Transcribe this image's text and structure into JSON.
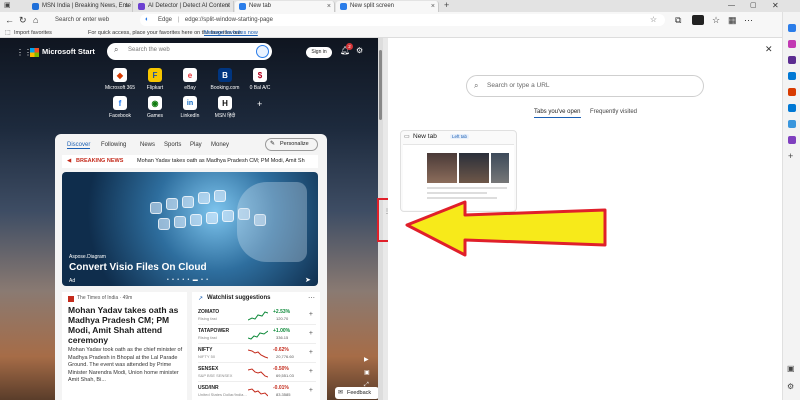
{
  "tabs": [
    {
      "title": "MSN India | Breaking News, Ente",
      "color": "#1e6fd9"
    },
    {
      "title": "AI Detector | Detect AI Content",
      "color": "#6b3fd1"
    },
    {
      "title": "New tab",
      "color": "#2b7de9"
    },
    {
      "title": "New split screen",
      "color": "#2b7de9"
    }
  ],
  "toolbar": {
    "left_address_placeholder": "Search or enter web address",
    "browser_name": "Edge",
    "url": "edge://split-window-starting-page"
  },
  "favorites": {
    "import_label": "Import favorites",
    "hint": "For quick access, place your favorites here on the favorites bar.",
    "manage_link": "Manage favorites now"
  },
  "msn": {
    "brand": "Microsoft Start",
    "search_placeholder": "Search the web",
    "signin": "Sign in",
    "notif_count": "2",
    "shortcuts": [
      {
        "label": "Microsoft 365",
        "glyph": "◆",
        "color": "#d83b01"
      },
      {
        "label": "Flipkart",
        "glyph": "F",
        "color": "#f7c600"
      },
      {
        "label": "eBay",
        "glyph": "e",
        "color": "#e53238"
      },
      {
        "label": "Booking.com",
        "glyph": "B",
        "color": "#003580"
      },
      {
        "label": "0 Bal A/C",
        "glyph": "$",
        "color": "#b2001f"
      },
      {
        "label": "Facebook",
        "glyph": "f",
        "color": "#1877f2"
      },
      {
        "label": "Games",
        "glyph": "◉",
        "color": "#107c10"
      },
      {
        "label": "LinkedIn",
        "glyph": "in",
        "color": "#0a66c2"
      },
      {
        "label": "MSN हिंदी",
        "glyph": "H",
        "color": "#111111"
      }
    ],
    "feed_tabs": [
      "Discover",
      "Following",
      "News",
      "Sports",
      "Play",
      "Money"
    ],
    "personalize": "Personalize",
    "breaking_label": "BREAKING NEWS",
    "breaking_text": "Mohan Yadav takes oath as Madhya Pradesh CM; PM Modi, Amit Sh",
    "hero": {
      "source": "Aspose.Diagram",
      "title": "Convert Visio Files On Cloud",
      "ad": "Ad"
    },
    "news": {
      "source": "The Times of India · 49m",
      "title": "Mohan Yadav takes oath as Madhya Pradesh CM; PM Modi, Amit Shah attend ceremony",
      "body": "Mohan Yadav took oath as the chief minister of Madhya Pradesh in Bhopal at the Lal Parade Ground. The event was attended by Prime Minister Narendra Modi, Union home minister Amit Shah, Bi..."
    },
    "watchlist": {
      "title": "Watchlist suggestions",
      "rows": [
        {
          "symbol": "ZOMATO",
          "sub": "Rising fast",
          "change": "+2.53%",
          "price": "120.70",
          "dir": "up"
        },
        {
          "symbol": "TATAPOWER",
          "sub": "Rising fast",
          "change": "+1.00%",
          "price": "336.15",
          "dir": "up"
        },
        {
          "symbol": "NIFTY",
          "sub": "NIFTY 50",
          "change": "-0.62%",
          "price": "20,776.60",
          "dir": "down"
        },
        {
          "symbol": "SENSEX",
          "sub": "S&P BSE SENSEX",
          "change": "-0.50%",
          "price": "69,551.03",
          "dir": "down"
        },
        {
          "symbol": "USD/INR",
          "sub": "United States Dollar/India...",
          "change": "-0.01%",
          "price": "83.3585",
          "dir": "down"
        }
      ]
    },
    "feedback": "Feedback"
  },
  "newtab": {
    "search_placeholder": "Search or type a URL",
    "tabs_open": "Tabs you've open",
    "frequently_visited": "Frequently visited",
    "card_title": "New tab",
    "card_badge": "Left tab"
  }
}
